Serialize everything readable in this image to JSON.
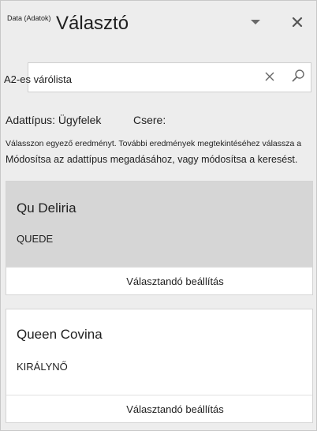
{
  "header": {
    "small_label": "Data (Adatok)",
    "title": "Választó"
  },
  "search": {
    "value": "A2-es várólista"
  },
  "meta": {
    "data_type": "Adattípus: Ügyfelek",
    "replace": "Csere:"
  },
  "hint": {
    "line1": "Válasszon egyező eredményt. További eredmények megtekintéséhez válassza a",
    "line2": "Módosítsa az adattípus megadásához, vagy módosítsa a keresést."
  },
  "results": [
    {
      "name": "Qu Deliria",
      "sub": "QUEDE",
      "action": "Választandó beállítás"
    },
    {
      "name": "Queen Covina",
      "sub": "KIRÁLYNŐ",
      "action": "Választandó beállítás"
    }
  ],
  "icons": {
    "dropdown": "chevron-down-icon",
    "close": "close-icon",
    "clear": "clear-icon",
    "search": "search-icon"
  }
}
